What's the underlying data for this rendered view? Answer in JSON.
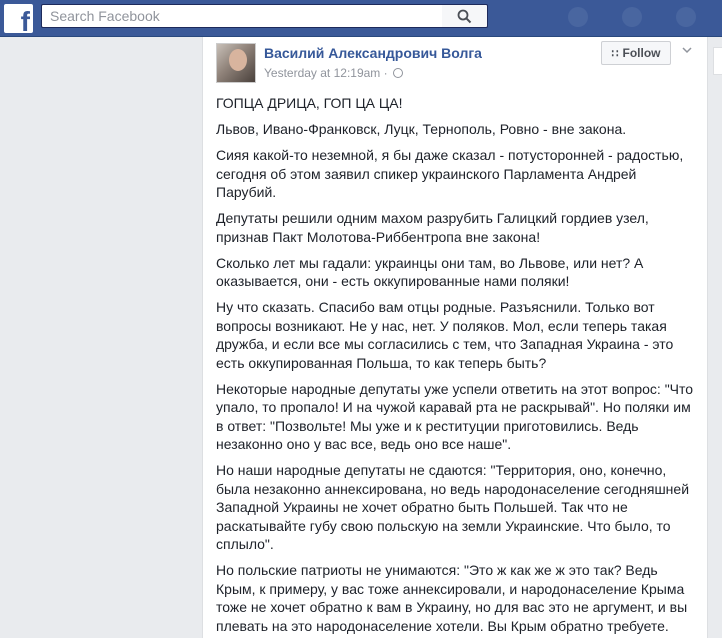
{
  "header": {
    "logo_letter": "f",
    "search_placeholder": "Search Facebook",
    "search_icon": "magnifier-icon"
  },
  "post": {
    "author": "Василий Александрович Волга",
    "timestamp": "Yesterday at 12:19am",
    "separator": "·",
    "privacy_icon": "globe-icon",
    "follow_label": "Follow",
    "paragraphs": [
      "ГОПЦА ДРИЦА, ГОП ЦА ЦА!",
      "Львов, Ивано-Франковск, Луцк, Тернополь, Ровно - вне закона.",
      "Сияя какой-то неземной, я бы даже сказал - потусторонней - радостью, сегодня об этом заявил спикер украинского Парламента Андрей Парубий.",
      "Депутаты решили одним махом разрубить Галицкий гордиев узел, признав Пакт Молотова-Риббентропа вне закона!",
      "Сколько лет мы гадали: украинцы они там, во Львове, или нет? А оказывается, они - есть оккупированные нами поляки!",
      "Ну что сказать. Спасибо вам отцы родные. Разъяснили. Только вот вопросы возникают. Не у нас, нет. У поляков. Мол, если теперь такая дружба, и если все мы согласились с тем, что Западная Украина - это есть оккупированная Польша, то как теперь быть?",
      "Некоторые народные депутаты уже успели ответить на этот вопрос: \"Что упало, то пропало! И на чужой каравай рта не раскрывай\". Но поляки им в ответ: \"Позвольте! Мы уже и к реституции приготовились. Ведь незаконно оно у вас все, ведь оно все наше\".",
      "Но наши народные депутаты не сдаются: \"Территория, оно, конечно, была незаконно аннексирована, но ведь народонаселение сегодняшней Западной Украины не хочет обратно быть Польшей. Так что не раскатывайте губу свою польскую на земли Украинские. Что было, то сплыло\".",
      "Но польские патриоты не унимаются: \"Это ж как же ж это так? Ведь Крым, к примеру, у вас тоже аннексировали, и народонаселение Крыма тоже не хочет обратно к вам в Украину, но для вас это не аргумент, и вы плевать на это народонаселение хотели. Вы Крым обратно требуете."
    ]
  }
}
